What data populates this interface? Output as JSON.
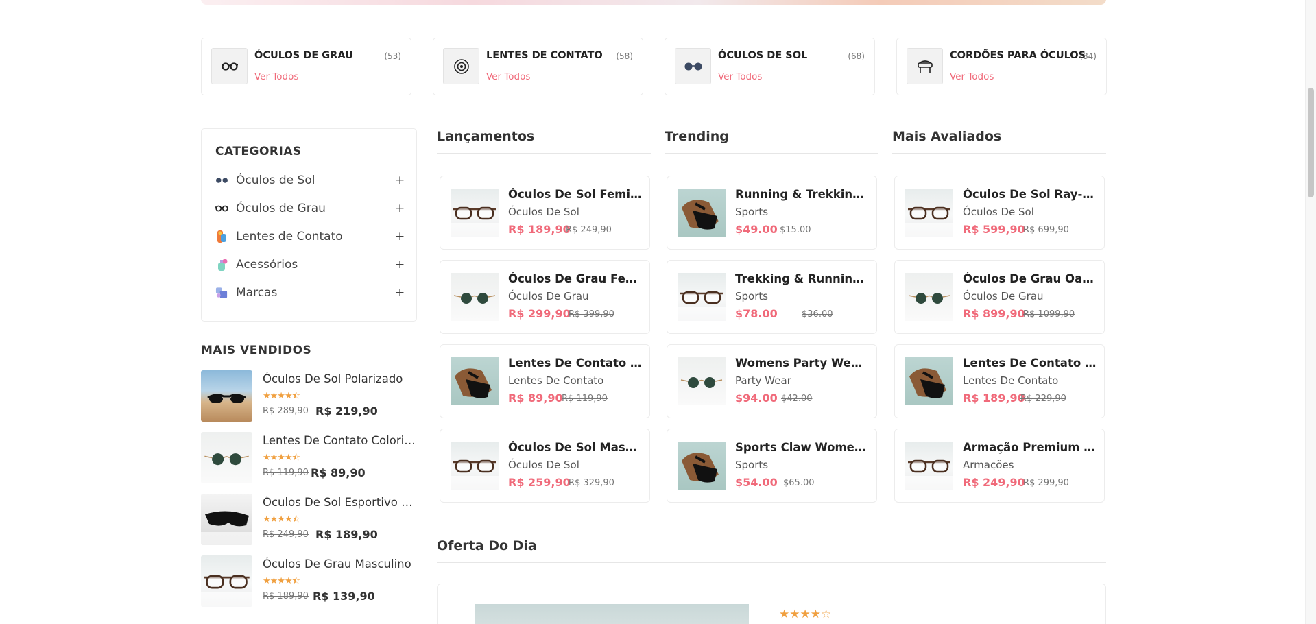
{
  "categories_top": [
    {
      "title": "ÓCULOS DE GRAU",
      "count": "(53)",
      "link": "Ver Todos",
      "icon": "glasses-icon"
    },
    {
      "title": "LENTES DE CONTATO",
      "count": "(58)",
      "link": "Ver Todos",
      "icon": "contact-lens-icon"
    },
    {
      "title": "ÓCULOS DE SOL",
      "count": "(68)",
      "link": "Ver Todos",
      "icon": "sunglasses-icon"
    },
    {
      "title": "CORDÕES PARA ÓCULOS",
      "count": "(84)",
      "link": "Ver Todos",
      "icon": "cord-icon"
    }
  ],
  "sidebar": {
    "heading": "CATEGORIAS",
    "items": [
      {
        "label": "Óculos de Sol",
        "toggle": "+",
        "icon": "sunglasses-icon"
      },
      {
        "label": "Óculos de Grau",
        "toggle": "+",
        "icon": "glasses-icon"
      },
      {
        "label": "Lentes de Contato",
        "toggle": "+",
        "icon": "contact-lens-icon"
      },
      {
        "label": "Acessórios",
        "toggle": "+",
        "icon": "accessories-icon"
      },
      {
        "label": "Marcas",
        "toggle": "+",
        "icon": "brand-icon"
      }
    ]
  },
  "mais_vendidos": {
    "heading": "MAIS VENDIDOS",
    "items": [
      {
        "name": "Óculos De Sol Polarizado",
        "stars": "★★★★⯪",
        "old_price": "R$ 289,90",
        "price": "R$ 219,90",
        "image": "beach"
      },
      {
        "name": "Lentes De Contato Coloridas",
        "stars": "★★★★⯪",
        "old_price": "R$ 119,90",
        "price": "R$ 89,90",
        "image": "green"
      },
      {
        "name": "Óculos De Sol Esportivo Masculino",
        "stars": "★★★★⯪",
        "old_price": "R$ 249,90",
        "price": "R$ 189,90",
        "image": "wrap"
      },
      {
        "name": "Óculos De Grau Masculino",
        "stars": "★★★★⯪",
        "old_price": "R$ 189,90",
        "price": "R$ 139,90",
        "image": "clear"
      }
    ]
  },
  "columns": [
    {
      "heading": "Lançamentos",
      "products": [
        {
          "name": "Óculos De Sol Feminino",
          "category": "Óculos De Sol",
          "price": "R$ 189,90",
          "old_price": "R$ 249,90",
          "image": "clear"
        },
        {
          "name": "Óculos De Grau Feminino",
          "category": "Óculos De Grau",
          "price": "R$ 299,90",
          "old_price": "R$ 399,90",
          "image": "green"
        },
        {
          "name": "Lentes De Contato Coloridas",
          "category": "Lentes De Contato",
          "price": "R$ 89,90",
          "old_price": "R$ 119,90",
          "image": "black"
        },
        {
          "name": "Óculos De Sol Masculino",
          "category": "Óculos De Sol",
          "price": "R$ 259,90",
          "old_price": "R$ 329,90",
          "image": "clear"
        }
      ]
    },
    {
      "heading": "Trending",
      "products": [
        {
          "name": "Running & Trekking Shoes",
          "category": "Sports",
          "price": "$49.00",
          "old_price": "$15.00",
          "image": "black"
        },
        {
          "name": "Trekking & Running Shoes",
          "category": "Sports",
          "price": "$78.00",
          "old_price": "$36.00",
          "image": "clear"
        },
        {
          "name": "Womens Party Wear Shoes",
          "category": "Party Wear",
          "price": "$94.00",
          "old_price": "$42.00",
          "image": "green"
        },
        {
          "name": "Sports Claw Women's Shoes",
          "category": "Sports",
          "price": "$54.00",
          "old_price": "$65.00",
          "image": "black"
        }
      ]
    },
    {
      "heading": "Mais Avaliados",
      "products": [
        {
          "name": "Óculos De Sol Ray-Ban",
          "category": "Óculos De Sol",
          "price": "R$ 599,90",
          "old_price": "R$ 699,90",
          "image": "clear"
        },
        {
          "name": "Óculos De Grau Oakley",
          "category": "Óculos De Grau",
          "price": "R$ 899,90",
          "old_price": "R$ 1099,90",
          "image": "green"
        },
        {
          "name": "Lentes De Contato Acuvue",
          "category": "Lentes De Contato",
          "price": "R$ 189,90",
          "old_price": "R$ 229,90",
          "image": "black"
        },
        {
          "name": "Armação Premium Para Óculos",
          "category": "Armações",
          "price": "R$ 249,90",
          "old_price": "R$ 299,90",
          "image": "clear"
        }
      ]
    }
  ],
  "oferta": {
    "heading": "Oferta Do Dia",
    "stars": "★★★★☆"
  },
  "colors": {
    "accent": "#f06a7a",
    "star": "#f0a040",
    "text": "#222222",
    "border": "#ececec"
  }
}
